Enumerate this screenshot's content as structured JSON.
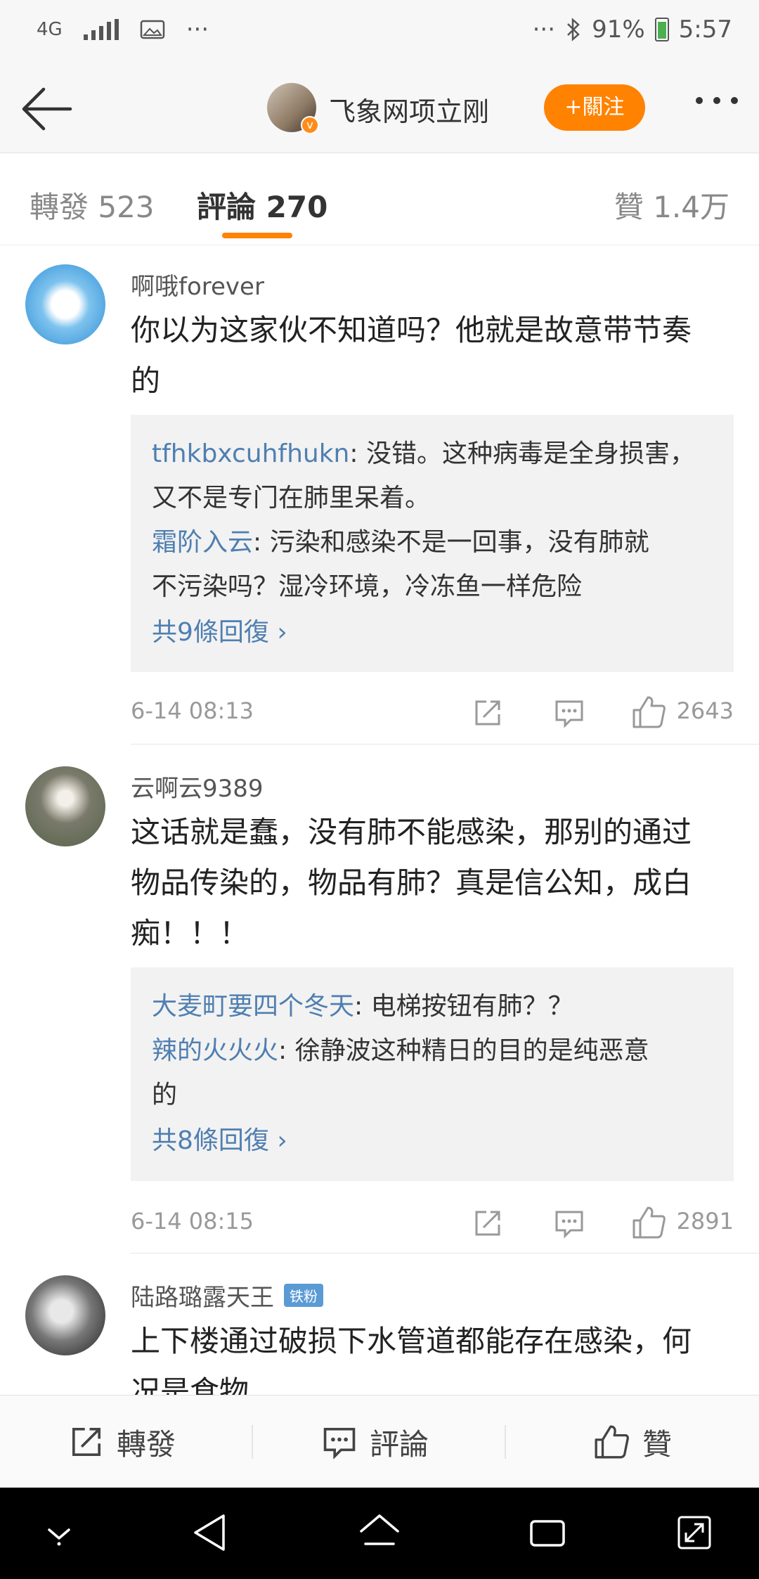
{
  "status_bar": {
    "network": "4G",
    "dots_left": "···",
    "dots_right": "···",
    "battery": "91%",
    "time": "5:57"
  },
  "header": {
    "title": "飞象网项立刚",
    "follow_label": "+關注",
    "verified_badge": "v"
  },
  "tabs": {
    "repost": "轉發 523",
    "comments": "評論 270",
    "likes": "贊 1.4万"
  },
  "comments": [
    {
      "user": "啊哦forever",
      "text_line1": "你以为这家伙不知道吗？他就是故意带节奏",
      "text_line2": "的",
      "replies": [
        {
          "user": "tfhkbxcuhfhukn",
          "text_line1": ": 没错。这种病毒是全身损害，",
          "text_line2": "又不是专门在肺里呆着。"
        },
        {
          "user": "霜阶入云",
          "text_line1": ": 污染和感染不是一回事，没有肺就",
          "text_line2": "不污染吗？湿冷环境，冷冻鱼一样危险"
        }
      ],
      "more_replies": "共9條回復 ›",
      "date": "6-14 08:13",
      "likes": "2643"
    },
    {
      "user": "云啊云9389",
      "text_line1": "这话就是蠢，没有肺不能感染，那别的通过",
      "text_line2": "物品传染的，物品有肺？真是信公知，成白",
      "text_line3": "痴！！！",
      "replies": [
        {
          "user": "大麦町要四个冬天",
          "text_line1": ": 电梯按钮有肺？？"
        },
        {
          "user": "辣的火火火",
          "text_line1": ": 徐静波这种精日的目的是纯恶意",
          "text_line2": "的"
        }
      ],
      "more_replies": "共8條回復 ›",
      "date": "6-14 08:15",
      "likes": "2891"
    },
    {
      "user": "陆路璐露天王",
      "badge": "铁粉",
      "text_line1": "上下楼通过破损下水管道都能存在感染，何",
      "text_line2": "况是食物"
    }
  ],
  "action_bar": {
    "repost": "轉發",
    "comment": "評論",
    "like": "贊"
  },
  "colors": {
    "accent": "#ff8200",
    "link": "#4f7fb1"
  }
}
